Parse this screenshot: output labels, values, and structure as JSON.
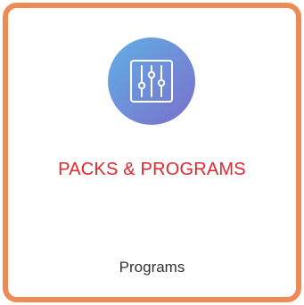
{
  "card": {
    "title": "PACKS & PROGRAMS",
    "subtitle": "Programs",
    "icon": "sliders-icon",
    "border_color": "#f08a55",
    "title_color": "#e2262e"
  }
}
